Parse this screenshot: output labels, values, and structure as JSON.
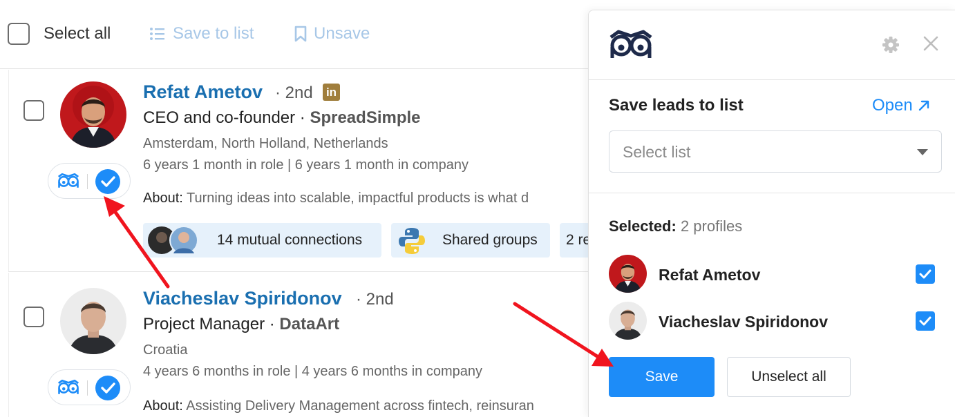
{
  "toolbar": {
    "select_all_label": "Select all",
    "save_to_list_label": "Save to list",
    "unsave_label": "Unsave"
  },
  "leads": [
    {
      "name": "Refat Ametov",
      "degree": "· 2nd",
      "linkedin_badge": "in",
      "title": "CEO and co-founder · ",
      "company": "SpreadSimple",
      "location": "Amsterdam, North Holland, Netherlands",
      "tenure": "6 years 1 month in role | 6 years 1 month in company",
      "about_label": "About:",
      "about_text": "Turning ideas into scalable, impactful products is what d",
      "chips": [
        "14 mutual connections",
        "Shared groups",
        "2 re"
      ]
    },
    {
      "name": "Viacheslav Spiridonov",
      "degree": "· 2nd",
      "title": "Project Manager · ",
      "company": "DataArt",
      "location": "Croatia",
      "tenure": "4 years 6 months in role | 4 years 6 months in company",
      "about_label": "About:",
      "about_text": "Assisting Delivery Management across fintech, reinsuran"
    }
  ],
  "panel": {
    "heading": "Save leads to list",
    "open_link": "Open",
    "select_placeholder": "Select list",
    "selected_label": "Selected:",
    "selected_count": "2 profiles",
    "selected_profiles": [
      {
        "name": "Refat Ametov",
        "checked": true
      },
      {
        "name": "Viacheslav Spiridonov",
        "checked": true
      }
    ],
    "save_button": "Save",
    "unselect_button": "Unselect all"
  },
  "colors": {
    "accent": "#1d8cf8",
    "name_link": "#1a6fb0",
    "muted_action": "#a7c7e7",
    "annotation_arrow": "#f0141e",
    "logo": "#1e2a4a"
  },
  "icons": [
    "list-icon",
    "bookmark-icon",
    "owl-logo-icon",
    "checkmark-icon",
    "linkedin-icon",
    "python-icon",
    "gear-icon",
    "close-icon",
    "external-link-icon",
    "caret-down-icon"
  ]
}
